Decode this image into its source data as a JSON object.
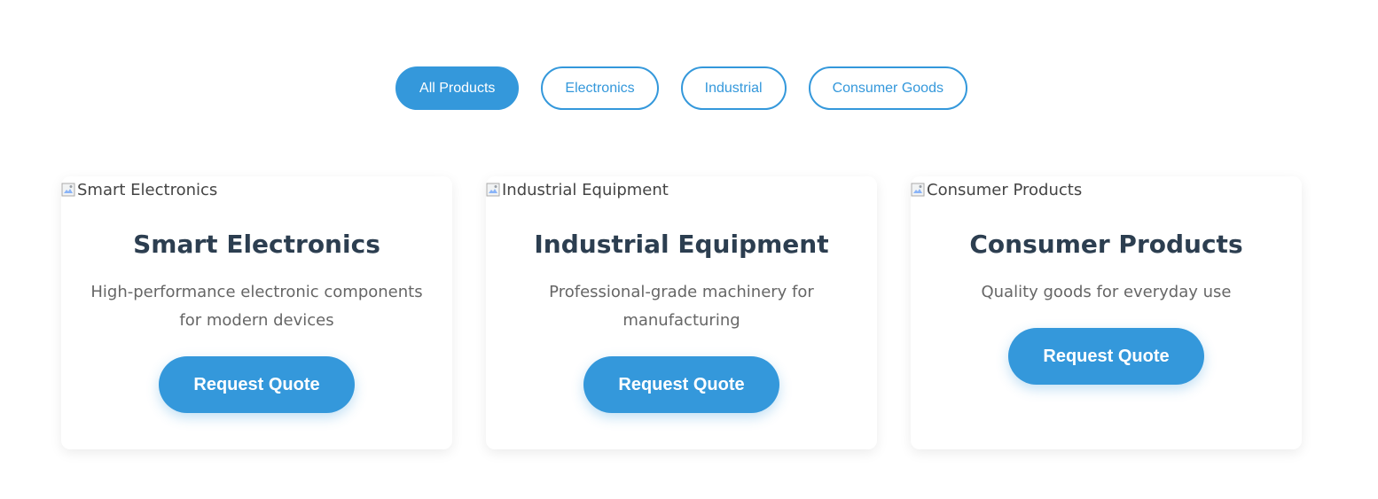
{
  "filters": {
    "all": "All Products",
    "electronics": "Electronics",
    "industrial": "Industrial",
    "consumer": "Consumer Goods",
    "active": "all"
  },
  "colors": {
    "accent": "#3498db",
    "title": "#2c3e50",
    "text": "#666666"
  },
  "products": [
    {
      "image_alt": "Smart Electronics",
      "title": "Smart Electronics",
      "description": "High-performance electronic components for modern devices",
      "button_label": "Request Quote"
    },
    {
      "image_alt": "Industrial Equipment",
      "title": "Industrial Equipment",
      "description": "Professional-grade machinery for manufacturing",
      "button_label": "Request Quote"
    },
    {
      "image_alt": "Consumer Products",
      "title": "Consumer Products",
      "description": "Quality goods for everyday use",
      "button_label": "Request Quote"
    }
  ]
}
